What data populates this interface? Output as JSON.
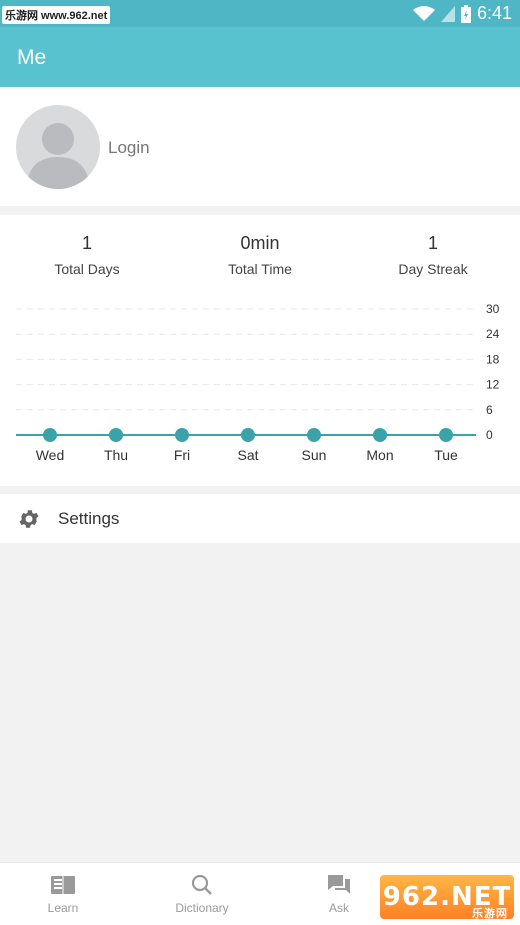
{
  "status_bar": {
    "watermark_text": "乐游网 www.962.net",
    "time": "6:41"
  },
  "app_bar": {
    "title": "Me"
  },
  "profile": {
    "login_label": "Login",
    "avatar_icon": "person-icon"
  },
  "stats": [
    {
      "value": "1",
      "label": "Total Days"
    },
    {
      "value": "0min",
      "label": "Total Time"
    },
    {
      "value": "1",
      "label": "Day Streak"
    }
  ],
  "chart_data": {
    "type": "line",
    "x": [
      "Wed",
      "Thu",
      "Fri",
      "Sat",
      "Sun",
      "Mon",
      "Tue"
    ],
    "y_ticks": [
      30,
      24,
      18,
      12,
      6,
      0
    ],
    "series": [
      {
        "values": [
          0,
          0,
          0,
          0,
          0,
          0,
          0
        ]
      }
    ],
    "ylim": [
      0,
      30
    ],
    "grid": true,
    "color": "#3aa3a9"
  },
  "settings": {
    "label": "Settings",
    "icon": "gear-icon"
  },
  "bottom_nav": [
    {
      "label": "Learn",
      "icon": "book-icon"
    },
    {
      "label": "Dictionary",
      "icon": "search-icon"
    },
    {
      "label": "Ask",
      "icon": "chat-icon"
    }
  ],
  "watermark": {
    "text": "962.NET",
    "subtext": "乐游网"
  },
  "colors": {
    "accent": "#58c2cf",
    "chart_line": "#3aa3a9"
  }
}
